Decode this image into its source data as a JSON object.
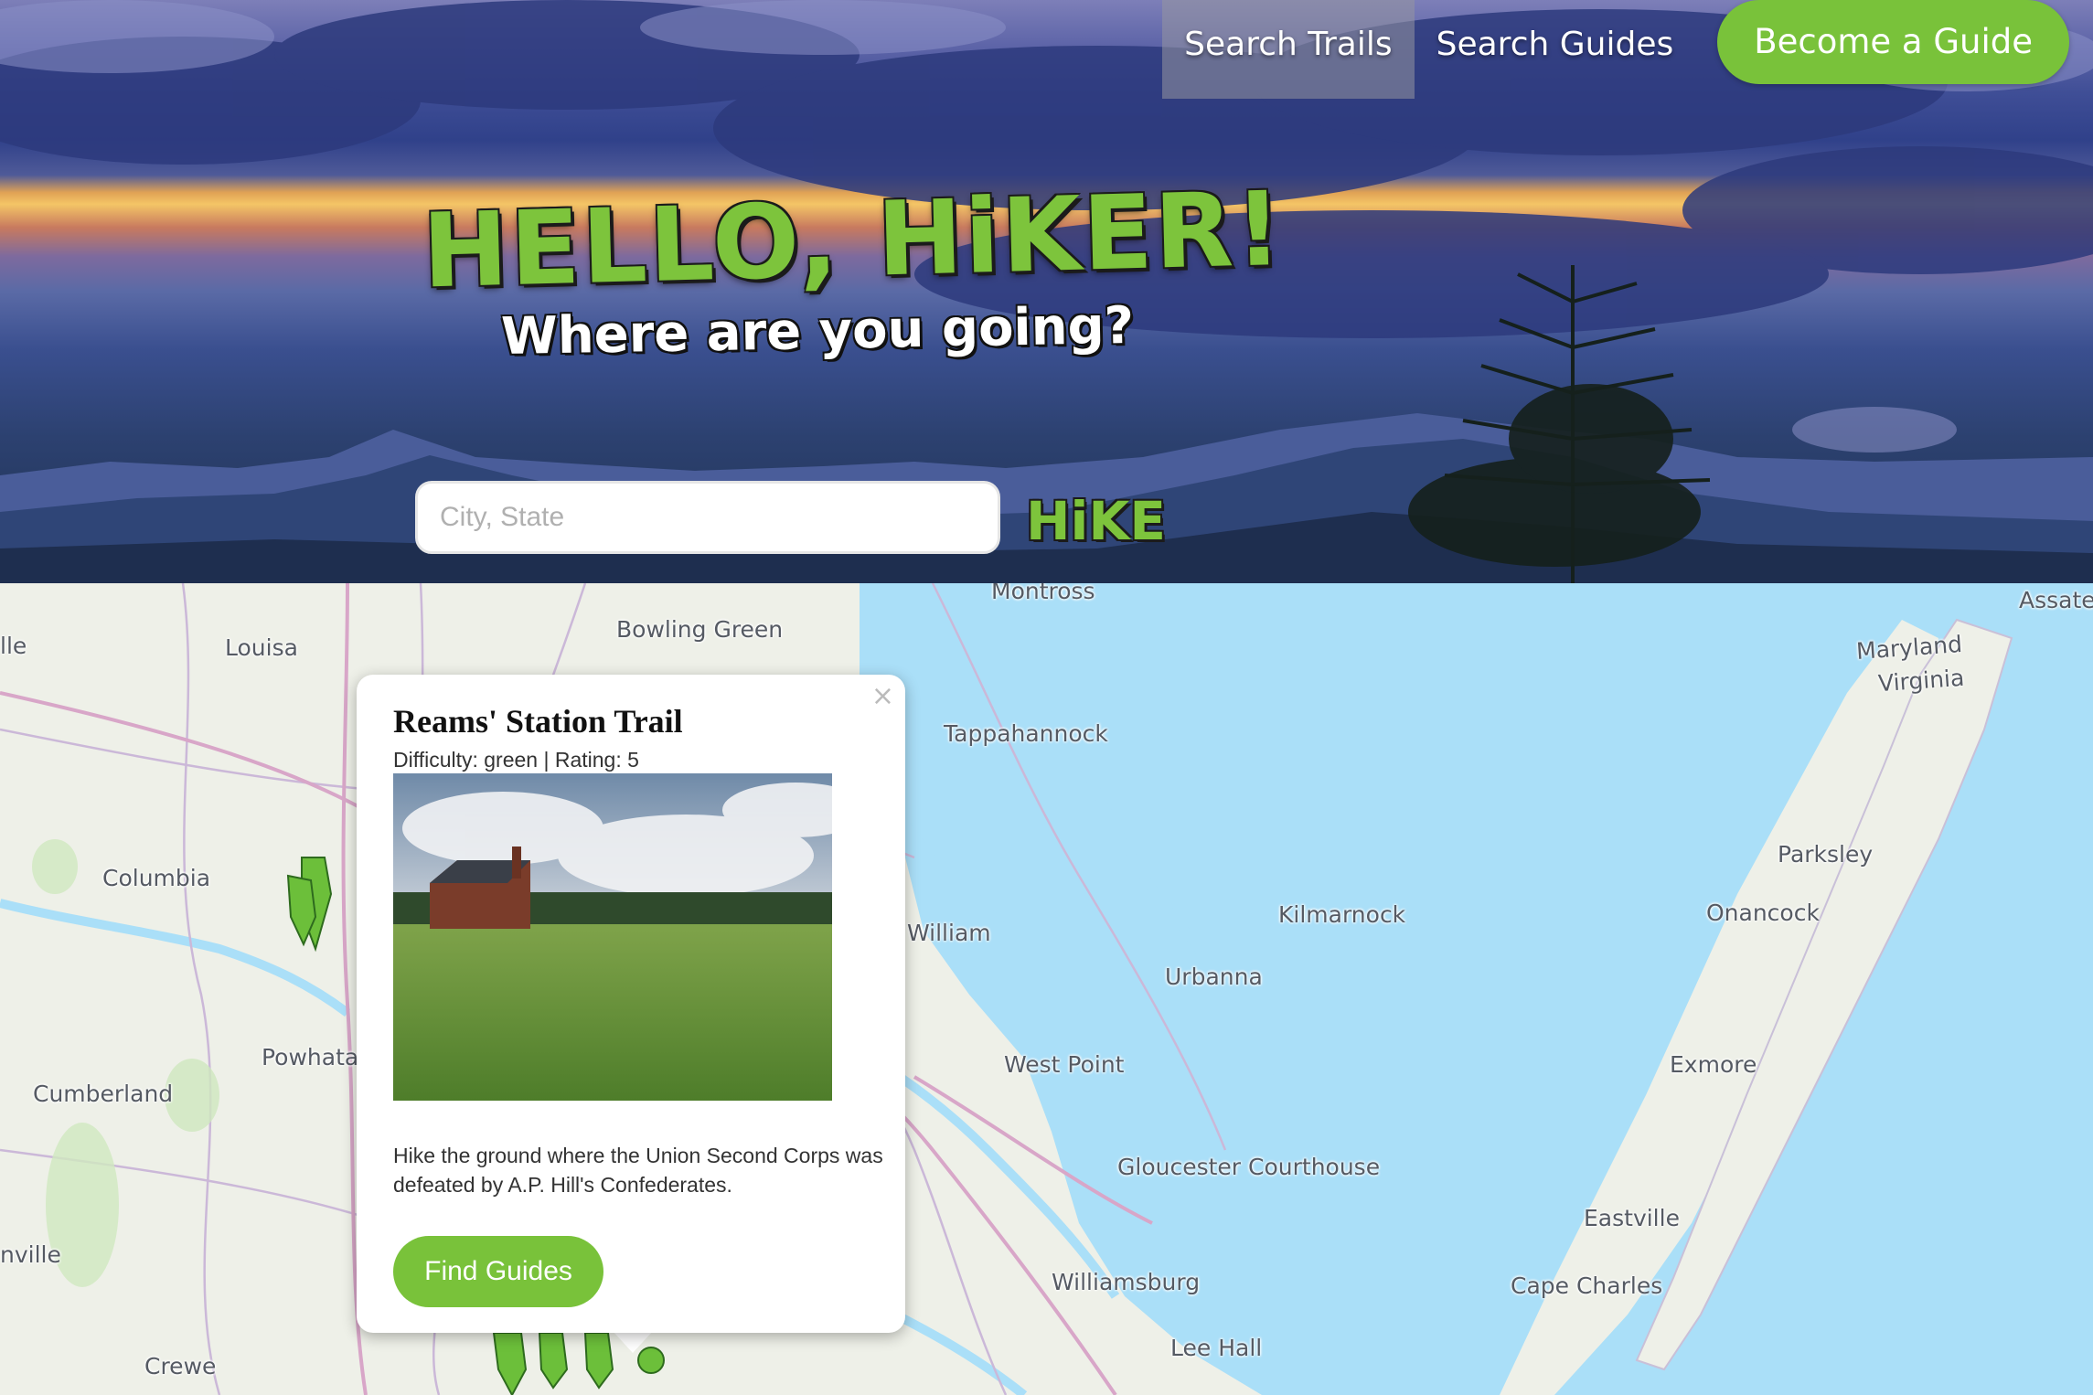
{
  "nav": {
    "items": [
      {
        "label": "Search Trails"
      },
      {
        "label": "Search Guides"
      }
    ],
    "cta_label": "Become a Guide"
  },
  "hero": {
    "headline": "HELLO, HiKER!",
    "subline": "Where are you going?",
    "search_placeholder": "City, State",
    "search_value": "",
    "submit_label": "HiKE"
  },
  "map": {
    "places": [
      {
        "name": "Montross"
      },
      {
        "name": "Bowling Green"
      },
      {
        "name": "Louisa"
      },
      {
        "name": "lle"
      },
      {
        "name": "Tappahannock"
      },
      {
        "name": "Maryland"
      },
      {
        "name": "Virginia"
      },
      {
        "name": "Assate"
      },
      {
        "name": "Parksley"
      },
      {
        "name": "Onancock"
      },
      {
        "name": "Columbia"
      },
      {
        "name": "Kilmarnock"
      },
      {
        "name": "William"
      },
      {
        "name": "Urbanna"
      },
      {
        "name": "Powhata"
      },
      {
        "name": "West Point"
      },
      {
        "name": "Exmore"
      },
      {
        "name": "Cumberland"
      },
      {
        "name": "Gloucester Courthouse"
      },
      {
        "name": "Eastville"
      },
      {
        "name": "nville"
      },
      {
        "name": "Williamsburg"
      },
      {
        "name": "Cape Charles"
      },
      {
        "name": "Crewe"
      },
      {
        "name": "Lee Hall"
      }
    ]
  },
  "popup": {
    "title": "Reams' Station Trail",
    "meta": "Difficulty: green | Rating: 5",
    "description": "Hike the ground where the Union Second Corps was defeated by A.P. Hill's Confederates.",
    "button_label": "Find Guides",
    "close_symbol": "×"
  },
  "colors": {
    "accent_green": "#79c23a",
    "water": "#aadff8",
    "land": "#eef0e8"
  }
}
